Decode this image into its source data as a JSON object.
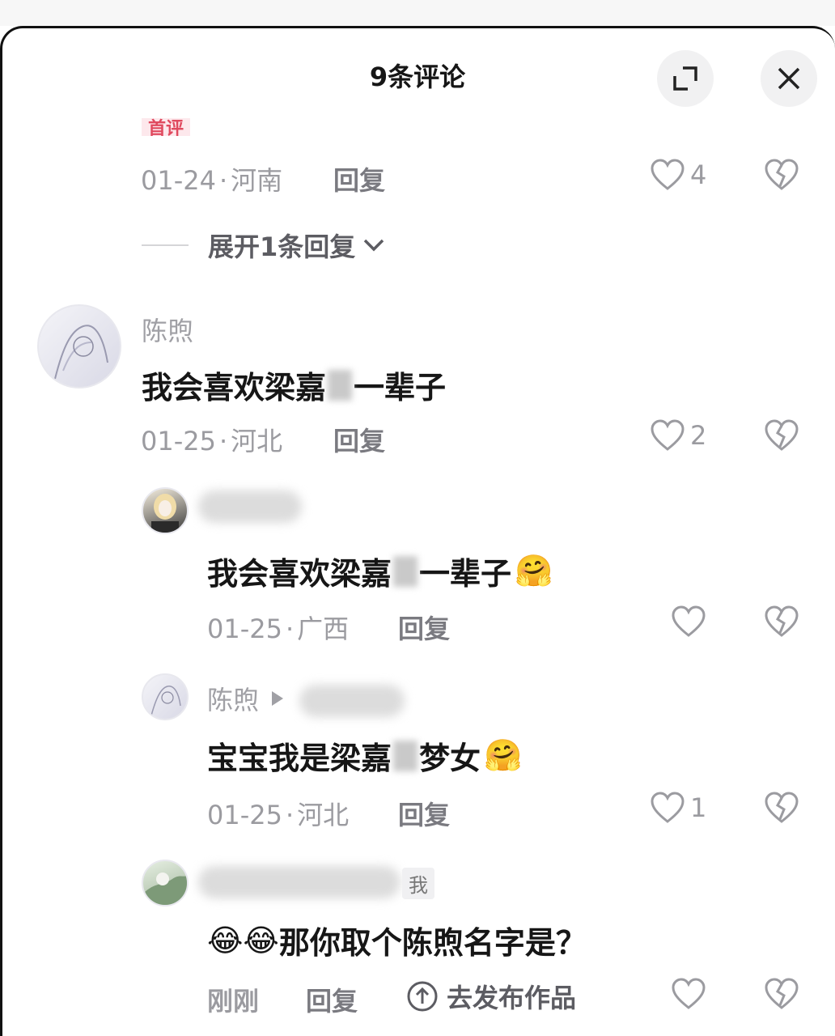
{
  "header": {
    "title": "9条评论",
    "expand_icon": "expand-icon",
    "close_icon": "close-icon"
  },
  "tag_top": "首评",
  "c0": {
    "date": "01-24",
    "region": "河南",
    "reply": "回复",
    "likes": "4"
  },
  "expand": {
    "label": "展开1条回复"
  },
  "c1": {
    "name": "陈煦",
    "text_a": "我会喜欢梁嘉",
    "text_b": "一辈子",
    "date": "01-25",
    "region": "河北",
    "reply": "回复",
    "likes": "2"
  },
  "r1": {
    "text_a": "我会喜欢梁嘉",
    "text_b": "一辈子",
    "emoji": "🤗",
    "date": "01-25",
    "region": "广西",
    "reply": "回复"
  },
  "r2": {
    "name": "陈煦",
    "text_a": "宝宝我是梁嘉",
    "text_b": "梦女",
    "emoji": "🤗",
    "date": "01-25",
    "region": "河北",
    "reply": "回复",
    "likes": "1"
  },
  "r3": {
    "me": "我",
    "emoji": "😂😂",
    "text": "那你取个陈煦名字是？",
    "time": "刚刚",
    "reply": "回复",
    "publish": "去发布作品"
  },
  "sep": "·"
}
